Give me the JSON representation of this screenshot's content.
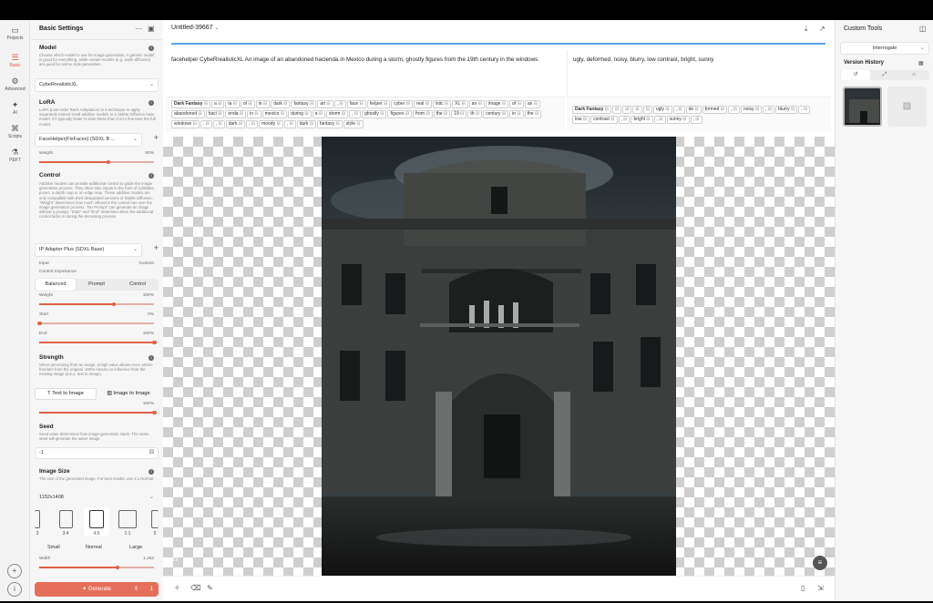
{
  "rail": {
    "items": [
      {
        "label": "Projects",
        "icon": "folder-icon"
      },
      {
        "label": "Basic",
        "icon": "sliders-icon"
      },
      {
        "label": "Advanced",
        "icon": "gear-icon"
      },
      {
        "label": "AI",
        "icon": "sparkle-icon"
      },
      {
        "label": "Scripts",
        "icon": "code-icon"
      },
      {
        "label": "PEFT",
        "icon": "beaker-icon"
      }
    ],
    "active": "Basic"
  },
  "settings": {
    "title": "Basic Settings",
    "model": {
      "title": "Model",
      "desc": "Choose which model to use for image generation. A generic model is good for everything, while certain models (e.g. waifu-diffusion) are good for anime style generation.",
      "value": "CybeRrealisticXL"
    },
    "lora": {
      "title": "LoRA",
      "desc": "LoRA (Low-order Rank Adaptation) is a technique to apply separately trained small additive models to a Stable Diffusion base model. It's typically faster to train these than it is to fine-tune the full model.",
      "value": "FaceHelper(FixFaces) (SDXL B ...",
      "weight_label": "Weight",
      "weight_value": "60%",
      "weight": 0.6
    },
    "control": {
      "title": "Control",
      "desc": "Additive models can provide additional control to guide the image generation process. They often take inputs in the form of scribbles, poses, a depth map or an edge map. These additive models are only compatible with their designated versions of Stable Diffusion. \"Weight\" determines how much influence the control has over the image generation process. \"No Prompt\" can generate an image without a prompt. \"Start\" and \"End\" determine when the additional control kicks in during the denoising process.",
      "value": "IP Adapter Plus (SDXL Base)",
      "input_label": "Input",
      "input_value": "Custom",
      "importance_label": "Control Importance",
      "importance_options": [
        "Balanced",
        "Prompt",
        "Control"
      ],
      "importance_selected": "Balanced",
      "weight_label": "Weight",
      "weight_value": "100%",
      "weight": 0.65,
      "start_label": "Start",
      "start_value": "0%",
      "start": 0.0,
      "end_label": "End",
      "end_value": "100%",
      "end": 1.0
    },
    "strength": {
      "title": "Strength",
      "desc": "When generating from an image, a high value allows more artistic freedom from the original. 100% means no influence from the existing image (a.k.a. text to image).",
      "text_to_image": "Text to Image",
      "image_to_image": "Image to Image",
      "value": "100%",
      "level": 1.0
    },
    "seed": {
      "title": "Seed",
      "desc": "Seed value determines how image generation starts. The same seed will generate the same image.",
      "value": "-1"
    },
    "image_size": {
      "title": "Image Size",
      "desc": "The size of the generated image. For best results, use 1:1 Normal",
      "value": "1152x1408",
      "ratios": [
        "3",
        "3:4",
        "4:5",
        "1:1",
        "5"
      ],
      "selected_ratio": "4:5",
      "sizes": [
        "Small",
        "Normal",
        "Large"
      ],
      "width_label": "Width",
      "width_value": "1,152",
      "width": 0.68
    },
    "generate_label": "Generate",
    "generate_count": "1"
  },
  "main": {
    "doc_title": "Untitled-39667",
    "progress": 1.0,
    "prompt": "facehelper CybeRrealisticXL An image of an abandoned hacienda in Mexico during a storm, ghostly figures from the 19th century in the windows.",
    "negative": "ugly, deformed, noisy, blurry, low contrast, bright, sunny",
    "prompt_tags": [
      "Dark Fantasy",
      "a",
      "la",
      "of",
      "in",
      "dark",
      "fantasy",
      "art",
      ",",
      "face",
      "helper",
      "cyber",
      "real",
      "istic",
      "XL",
      "an",
      "image",
      "of",
      "an",
      "abandoned",
      "haci",
      "enda",
      "in",
      "mexico",
      "during",
      "a",
      "storm",
      ",",
      "ghostly",
      "figures",
      "from",
      "the",
      "19",
      "th",
      "century",
      "in",
      "the",
      "windows",
      ".",
      ",",
      "dark",
      ",",
      "moody",
      ",",
      "dark",
      "fantasy",
      "style"
    ],
    "negative_tags": [
      "Dark Fantasy",
      "",
      "",
      "",
      "",
      "ugly",
      ",",
      "de",
      "formed",
      ",",
      "noisy",
      ",",
      "blurry",
      ",",
      "low",
      "contrast",
      ",",
      "bright",
      ",",
      "sunny",
      ","
    ],
    "zoom_badge": "1x"
  },
  "right": {
    "title": "Custom Tools",
    "interrogate": "Interrogate",
    "version_history": "Version History"
  }
}
